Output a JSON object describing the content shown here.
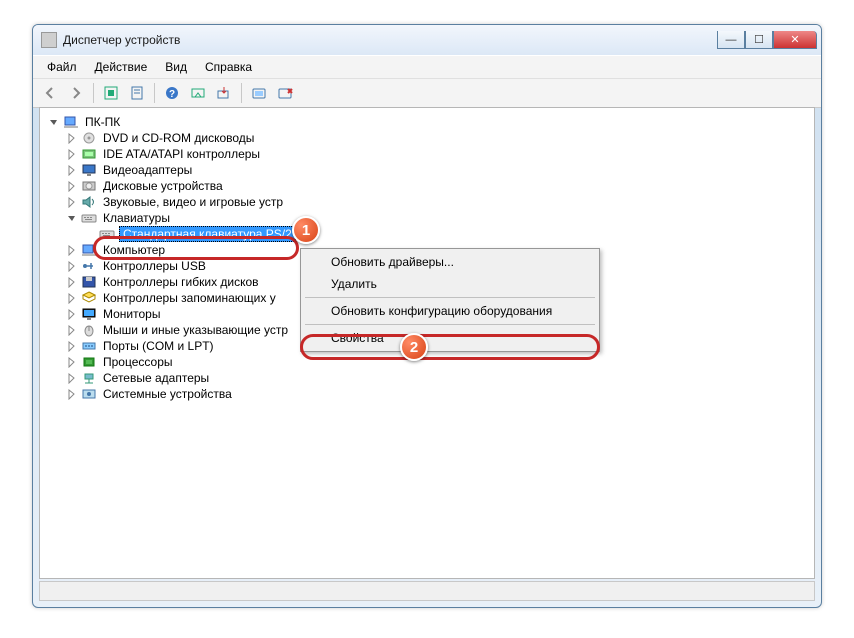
{
  "window": {
    "title": "Диспетчер устройств"
  },
  "menu": {
    "file": "Файл",
    "action": "Действие",
    "view": "Вид",
    "help": "Справка"
  },
  "tree": {
    "root": "ПК-ПК",
    "items": [
      {
        "label": "DVD и CD-ROM дисководы",
        "icon": "disc"
      },
      {
        "label": "IDE ATA/ATAPI контроллеры",
        "icon": "ide"
      },
      {
        "label": "Видеоадаптеры",
        "icon": "display"
      },
      {
        "label": "Дисковые устройства",
        "icon": "disk"
      },
      {
        "label": "Звуковые, видео и игровые устр",
        "icon": "audio"
      },
      {
        "label": "Клавиатуры",
        "icon": "keyboard",
        "expanded": true,
        "children": [
          {
            "label": "Стандартная клавиатура PS/2",
            "icon": "keyboard",
            "selected": true
          }
        ]
      },
      {
        "label": "Компьютер",
        "icon": "computer"
      },
      {
        "label": "Контроллеры USB",
        "icon": "usb"
      },
      {
        "label": "Контроллеры гибких дисков",
        "icon": "floppy"
      },
      {
        "label": "Контроллеры запоминающих у",
        "icon": "storage"
      },
      {
        "label": "Мониторы",
        "icon": "monitor"
      },
      {
        "label": "Мыши и иные указывающие устр",
        "icon": "mouse"
      },
      {
        "label": "Порты (COM и LPT)",
        "icon": "port"
      },
      {
        "label": "Процессоры",
        "icon": "cpu"
      },
      {
        "label": "Сетевые адаптеры",
        "icon": "network"
      },
      {
        "label": "Системные устройства",
        "icon": "system"
      }
    ]
  },
  "context_menu": {
    "update_drivers": "Обновить драйверы...",
    "delete": "Удалить",
    "scan_hw": "Обновить конфигурацию оборудования",
    "properties": "Свойства"
  },
  "annotations": {
    "badge1": "1",
    "badge2": "2"
  }
}
